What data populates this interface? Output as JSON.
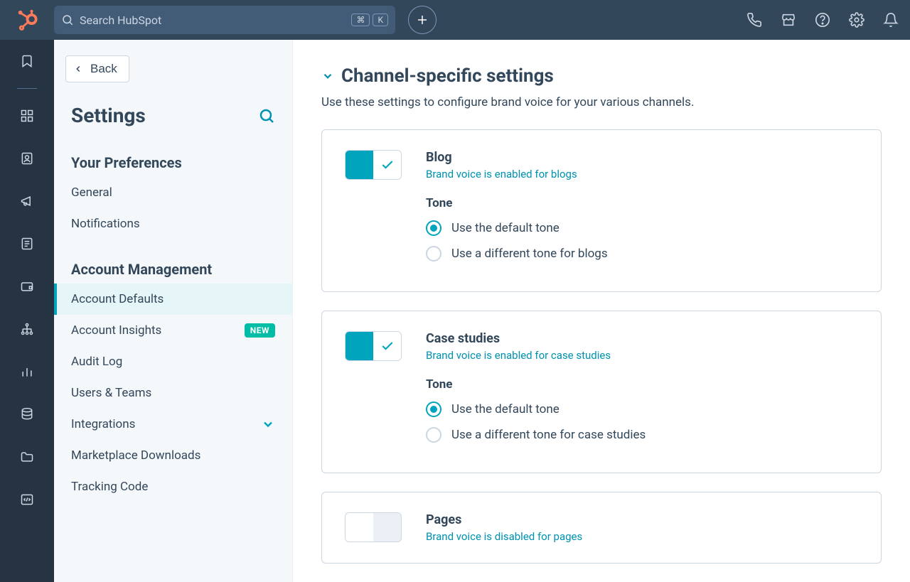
{
  "topbar": {
    "search_placeholder": "Search HubSpot",
    "kbd1": "⌘",
    "kbd2": "K"
  },
  "sidebar": {
    "back": "Back",
    "title": "Settings",
    "section1": "Your Preferences",
    "pref_items": [
      "General",
      "Notifications"
    ],
    "section2": "Account Management",
    "acct_items": [
      {
        "label": "Account Defaults",
        "active": true
      },
      {
        "label": "Account Insights",
        "badge": "NEW"
      },
      {
        "label": "Audit Log"
      },
      {
        "label": "Users & Teams"
      },
      {
        "label": "Integrations",
        "expandable": true
      },
      {
        "label": "Marketplace Downloads"
      },
      {
        "label": "Tracking Code"
      }
    ]
  },
  "main": {
    "title": "Channel-specific settings",
    "desc": "Use these settings to configure brand voice for your various channels.",
    "tone_heading": "Tone",
    "cards": [
      {
        "title": "Blog",
        "sub": "Brand voice is enabled for blogs",
        "enabled": true,
        "opt1": "Use the default tone",
        "opt2": "Use a different tone for blogs"
      },
      {
        "title": "Case studies",
        "sub": "Brand voice is enabled for case studies",
        "enabled": true,
        "opt1": "Use the default tone",
        "opt2": "Use a different tone for case studies"
      },
      {
        "title": "Pages",
        "sub": "Brand voice is disabled for pages",
        "enabled": false
      }
    ]
  }
}
